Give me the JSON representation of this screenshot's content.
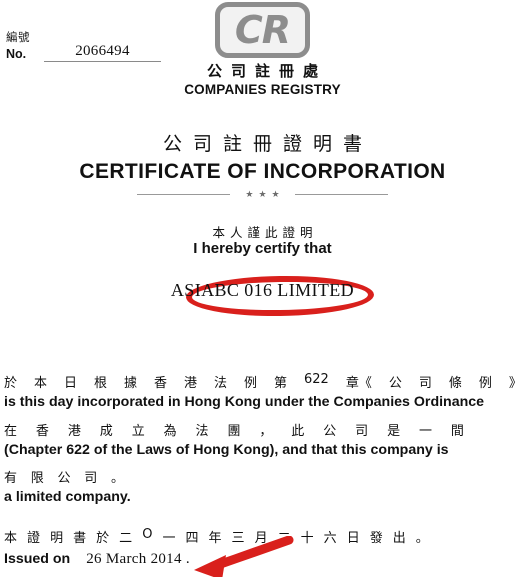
{
  "document": {
    "type": "Certificate of Incorporation",
    "issuer_mark": "CR"
  },
  "header": {
    "number_label_cn": "編號",
    "number_label_en": "No.",
    "number_value": "2066494",
    "logo_text": "CR",
    "registry_cn": "公司註冊處",
    "registry_en": "COMPANIES REGISTRY"
  },
  "title": {
    "cn": "公司註冊證明書",
    "en": "CERTIFICATE OF INCORPORATION",
    "divider_stars": "★★★"
  },
  "certify": {
    "cn": "本人謹此證明",
    "en": "I hereby certify that"
  },
  "company": {
    "name": "ASIABC 016 LIMITED",
    "highlight_color": "#d9201c"
  },
  "body": [
    {
      "cn_parts": [
        "於",
        "本",
        "日",
        "根",
        "據",
        "香",
        "港",
        "法",
        "例",
        "第",
        "622",
        "章《",
        "公",
        "司",
        "條",
        "例",
        "》"
      ],
      "en": "is this day incorporated in Hong Kong under the Companies Ordinance"
    },
    {
      "cn_parts": [
        "在",
        "香",
        "港",
        "成",
        "立",
        "為",
        "法",
        "團",
        "，",
        "此",
        "公",
        "司",
        "是",
        "一",
        "間"
      ],
      "en": "(Chapter 622 of the Laws of Hong Kong), and that this company is"
    },
    {
      "cn_parts": [
        "有",
        "限",
        "公",
        "司",
        "。"
      ],
      "en": "a limited company."
    }
  ],
  "issued": {
    "cn_parts": [
      "本",
      "證",
      "明",
      "書",
      "於",
      "二",
      "O",
      "一",
      "四",
      "年",
      "三",
      "月",
      "二",
      "十",
      "六",
      "日",
      "發",
      "出",
      "。"
    ],
    "label_en": "Issued on",
    "date_en": "26 March 2014 ."
  },
  "annotations": {
    "arrow_color": "#d9201c",
    "circle_color": "#d9201c"
  }
}
